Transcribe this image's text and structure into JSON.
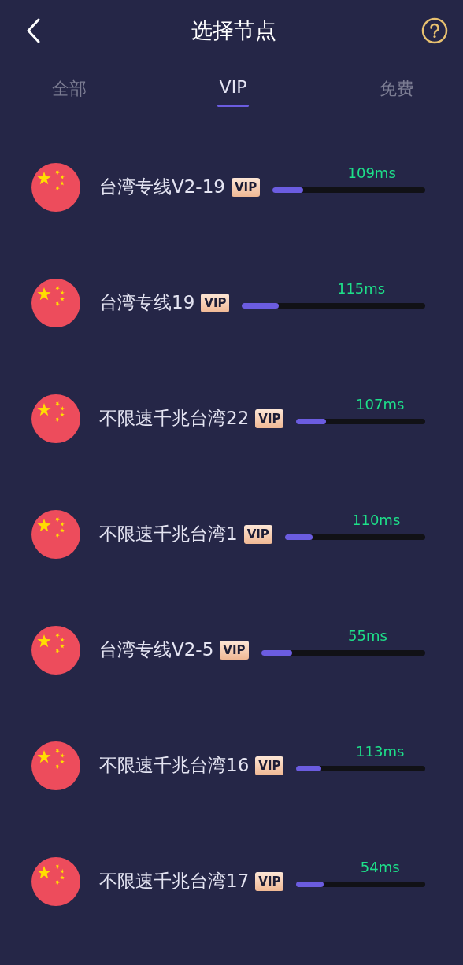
{
  "header": {
    "title": "选择节点"
  },
  "tabs": [
    {
      "label": "全部",
      "selected": false
    },
    {
      "label": "VIP",
      "selected": true
    },
    {
      "label": "免费",
      "selected": false
    }
  ],
  "nodes": [
    {
      "name": "台湾专线V2-19",
      "badge": "VIP",
      "latency": "109ms",
      "level": 0.2
    },
    {
      "name": "台湾专线19",
      "badge": "VIP",
      "latency": "115ms",
      "level": 0.2
    },
    {
      "name": "不限速千兆台湾22",
      "badge": "VIP",
      "latency": "107ms",
      "level": 0.23
    },
    {
      "name": "不限速千兆台湾1",
      "badge": "VIP",
      "latency": "110ms",
      "level": 0.2
    },
    {
      "name": "台湾专线V2-5",
      "badge": "VIP",
      "latency": "55ms",
      "level": 0.19
    },
    {
      "name": "不限速千兆台湾16",
      "badge": "VIP",
      "latency": "113ms",
      "level": 0.19
    },
    {
      "name": "不限速千兆台湾17",
      "badge": "VIP",
      "latency": "54ms",
      "level": 0.21
    }
  ]
}
